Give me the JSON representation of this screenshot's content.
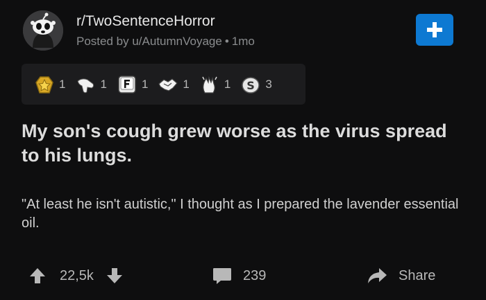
{
  "post": {
    "subreddit": "r/TwoSentenceHorror",
    "posted_by_prefix": "Posted by",
    "author": "u/AutumnVoyage",
    "separator": "•",
    "age": "1mo",
    "title": "My son's cough grew worse as the virus spread to his lungs.",
    "body": "\"At least he isn't autistic,\" I thought as I prepared the lavender essential oil."
  },
  "awards": [
    {
      "icon": "gold-star-award-icon",
      "count": "1"
    },
    {
      "icon": "hand-award-icon",
      "count": "1"
    },
    {
      "icon": "press-f-award-icon",
      "count": "1"
    },
    {
      "icon": "handshake-award-icon",
      "count": "1"
    },
    {
      "icon": "clapping-hands-award-icon",
      "count": "1"
    },
    {
      "icon": "silver-s-award-icon",
      "count": "3"
    }
  ],
  "actions": {
    "votes": "22,5k",
    "comments": "239",
    "share_label": "Share"
  },
  "colors": {
    "background": "#0e0e0f",
    "join_button": "#0d79d2",
    "awards_panel": "#1c1c1e"
  }
}
